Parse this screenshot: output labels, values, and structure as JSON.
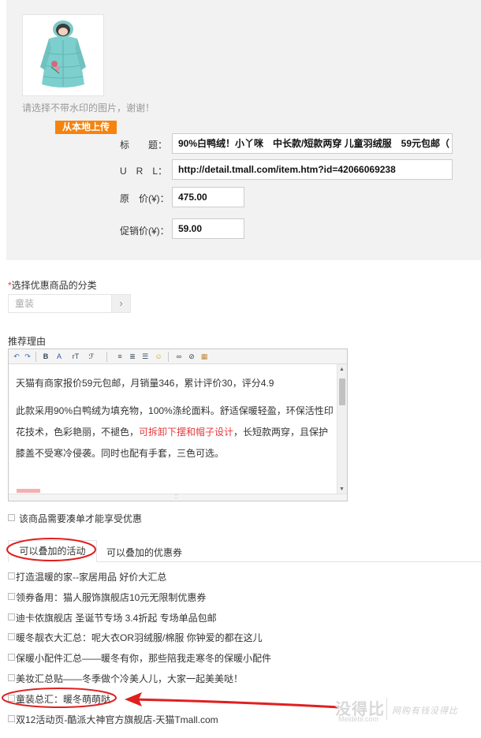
{
  "product": {
    "image_icon": "girls-down-jacket-photo",
    "hint": "请选择不带水印的图片，谢谢！",
    "upload_label": "从本地上传"
  },
  "fields": {
    "title_label": "标　　题：",
    "title_value": "90%白鸭绒！小丫咪　中长款/短款两穿 儿童羽绒服　59元包邮（",
    "url_label": "U　R　L：",
    "url_value": "http://detail.tmall.com/item.htm?id=42066069238",
    "price_label": "原　价(¥)：",
    "price_value": "475.00",
    "promo_label": "促销价(¥)：",
    "promo_value": "59.00"
  },
  "category": {
    "required_mark": "*",
    "label": "选择优惠商品的分类",
    "value": "童装",
    "arrow": "›"
  },
  "reason": {
    "label": "推荐理由",
    "line1": "天猫有商家报价59元包邮，月销量346，累计评价30，评分4.9",
    "line2_pre": "此款采用90%白鸭绒为填充物，100%涤纶面料。舒适保暖轻盈，环保活性印花技术，色彩艳丽，不褪色，",
    "line2_red": "可拆卸下摆和帽子设计",
    "line2_post": "，长短款两穿，且保护膝盖不受寒冷侵袭。同时也配有手套，三色可选。"
  },
  "toolbar": {
    "undo_icon": "↶",
    "redo_icon": "↷",
    "bold": "B",
    "fontcolor": "A",
    "fontsize": "rT",
    "fontfamily": "ℱ",
    "align_left_icon": "≡",
    "align_center_icon": "≣",
    "align_right_icon": "☰",
    "emoji_icon": "☺",
    "link_icon": "∞",
    "unlink_icon": "⊘",
    "image_icon": "▦"
  },
  "bundle_checkbox_label": "该商品需要凑单才能享受优惠",
  "tabs": {
    "activities": "可以叠加的活动",
    "coupons": "可以叠加的优惠券"
  },
  "activities": [
    "打造温暖的家--家居用品 好价大汇总",
    "领券备用：猫人服饰旗舰店10元无限制优惠券",
    "迪卡侬旗舰店 圣诞节专场 3.4折起 专场单品包邮",
    "暖冬靓衣大汇总：呢大衣OR羽绒服/棉服 你钟爱的都在这儿",
    "保暖小配件汇总——暖冬有你，那些陪我走寒冬的保暖小配件",
    "美妆汇总贴——冬季做个冷美人儿，大家一起美美哒！",
    "童装总汇：暖冬萌萌哒",
    "双12活动页-酷派大神官方旗舰店-天猫Tmall.com"
  ],
  "watermark": {
    "logo": "没得比",
    "domain": "Meidebi.com",
    "slogan": "网购有钱没得比"
  },
  "annotation_color": "#e02020"
}
